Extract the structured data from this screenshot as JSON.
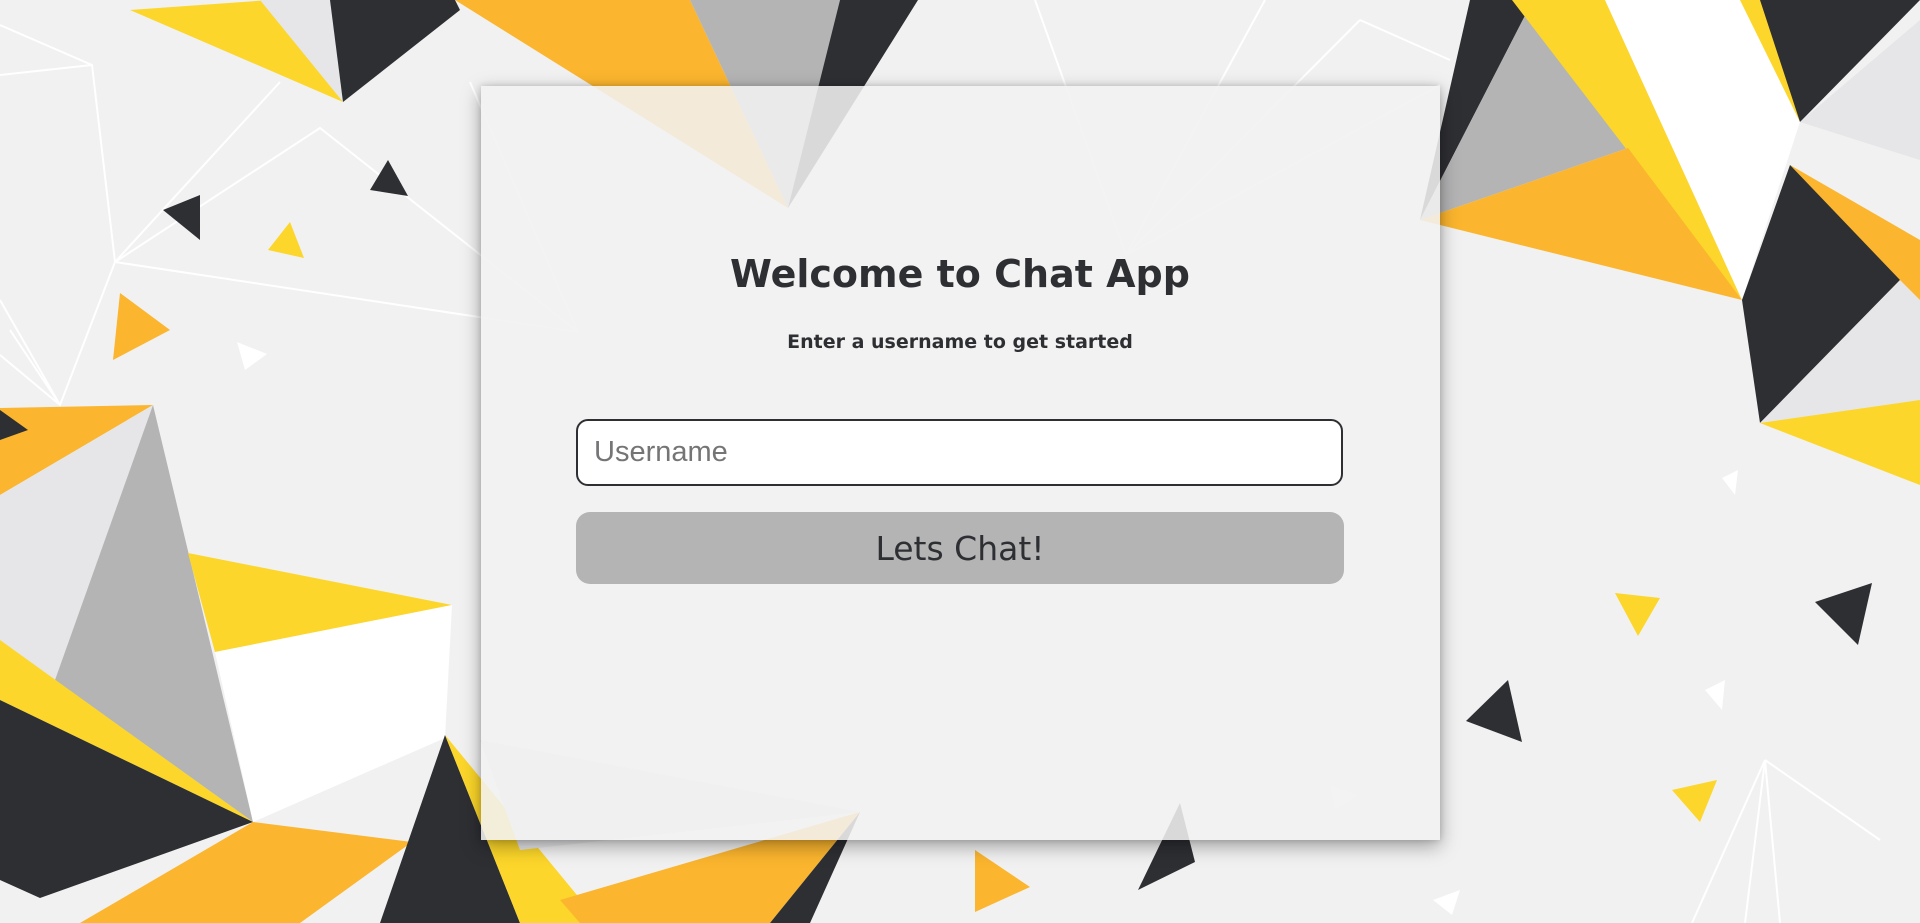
{
  "colors": {
    "background": "#f1f1f1",
    "dark": "#2e2f33",
    "orange": "#fbb52e",
    "yellow": "#fcd62a",
    "gray": "#b4b4b5",
    "light": "#e6e6e8",
    "white": "#ffffff"
  },
  "welcome": {
    "title": "Welcome to Chat App",
    "subtitle": "Enter a username to get started"
  },
  "form": {
    "username_placeholder": "Username",
    "username_value": "",
    "submit_label": "Lets Chat!"
  }
}
